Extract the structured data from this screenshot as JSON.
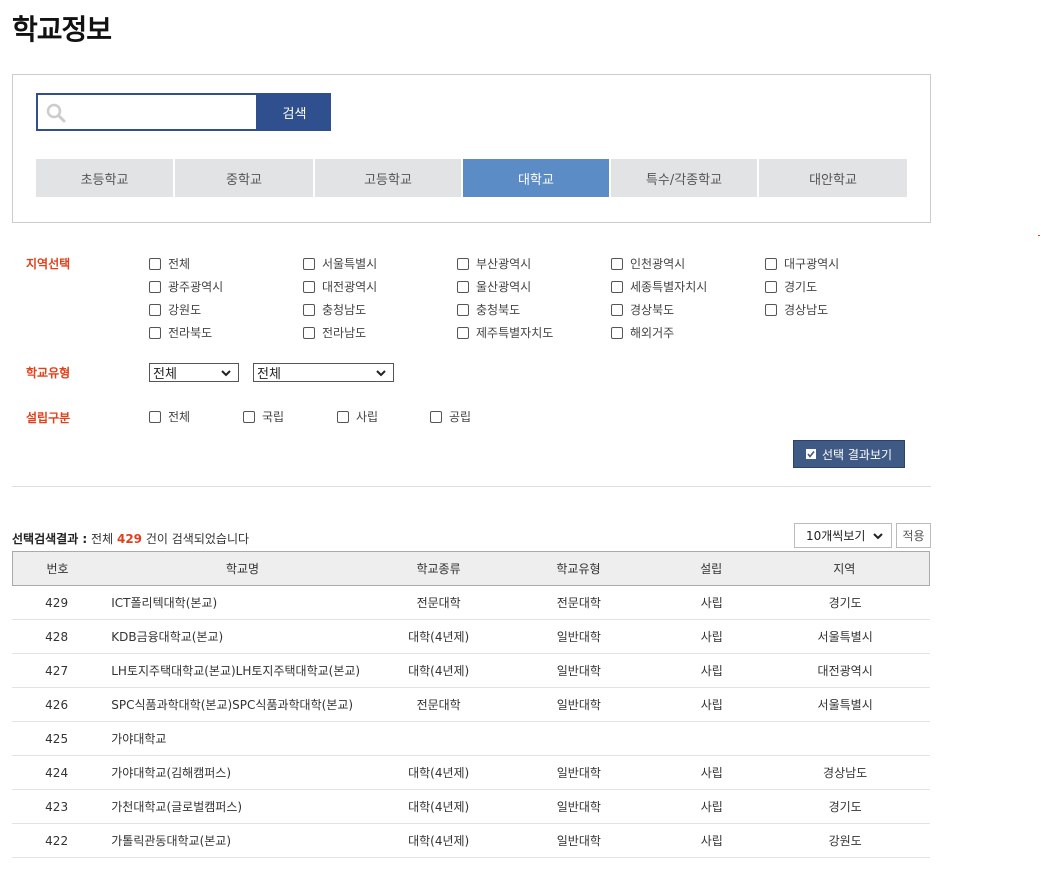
{
  "page": {
    "title": "학교정보"
  },
  "search": {
    "placeholder": "",
    "button_label": "검색"
  },
  "tabs": [
    {
      "label": "초등학교",
      "active": false
    },
    {
      "label": "중학교",
      "active": false
    },
    {
      "label": "고등학교",
      "active": false
    },
    {
      "label": "대학교",
      "active": true
    },
    {
      "label": "특수/각종학교",
      "active": false
    },
    {
      "label": "대안학교",
      "active": false
    }
  ],
  "filters": {
    "region": {
      "label": "지역선택",
      "options": [
        "전체",
        "서울특별시",
        "부산광역시",
        "인천광역시",
        "대구광역시",
        "광주광역시",
        "대전광역시",
        "울산광역시",
        "세종특별자치시",
        "경기도",
        "강원도",
        "충청남도",
        "충청북도",
        "경상북도",
        "경상남도",
        "전라북도",
        "전라남도",
        "제주특별자치도",
        "해외거주"
      ]
    },
    "school_type": {
      "label": "학교유형",
      "select1": "전체",
      "select2": "전체"
    },
    "establishment": {
      "label": "설립구분",
      "options": [
        "전체",
        "국립",
        "사립",
        "공립"
      ]
    },
    "result_button": "선택 결과보기"
  },
  "results": {
    "label": "선택검색결과 :",
    "prefix": "전체",
    "count": "429",
    "suffix": "건이 검색되었습니다",
    "page_size": "10개씩보기",
    "apply_label": "적용",
    "headers": {
      "no": "번호",
      "name": "학교명",
      "kind": "학교종류",
      "type": "학교유형",
      "est": "설립",
      "region": "지역"
    },
    "rows": [
      {
        "no": "429",
        "name": "ICT폴리텍대학(본교)",
        "kind": "전문대학",
        "type": "전문대학",
        "est": "사립",
        "region": "경기도"
      },
      {
        "no": "428",
        "name": "KDB금융대학교(본교)",
        "kind": "대학(4년제)",
        "type": "일반대학",
        "est": "사립",
        "region": "서울특별시"
      },
      {
        "no": "427",
        "name": "LH토지주택대학교(본교)LH토지주택대학교(본교)",
        "kind": "대학(4년제)",
        "type": "일반대학",
        "est": "사립",
        "region": "대전광역시"
      },
      {
        "no": "426",
        "name": "SPC식품과학대학(본교)SPC식품과학대학(본교)",
        "kind": "전문대학",
        "type": "일반대학",
        "est": "사립",
        "region": "서울특별시"
      },
      {
        "no": "425",
        "name": "가야대학교",
        "kind": "",
        "type": "",
        "est": "",
        "region": ""
      },
      {
        "no": "424",
        "name": "가야대학교(김해캠퍼스)",
        "kind": "대학(4년제)",
        "type": "일반대학",
        "est": "사립",
        "region": "경상남도"
      },
      {
        "no": "423",
        "name": "가천대학교(글로벌캠퍼스)",
        "kind": "대학(4년제)",
        "type": "일반대학",
        "est": "사립",
        "region": "경기도"
      },
      {
        "no": "422",
        "name": "가톨릭관동대학교(본교)",
        "kind": "대학(4년제)",
        "type": "일반대학",
        "est": "사립",
        "region": "강원도"
      }
    ]
  },
  "colors": {
    "primary": "#2f4f8f",
    "active_tab": "#5b8cc5",
    "accent_red": "#e2401a",
    "result_button": "#3f5a85"
  }
}
